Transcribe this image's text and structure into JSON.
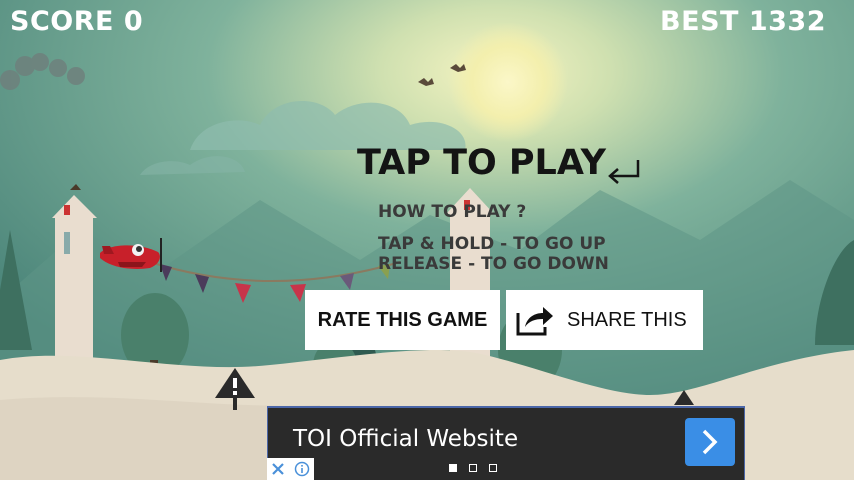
{
  "hud": {
    "score_label": "SCORE",
    "score_value": "0",
    "best_label": "BEST",
    "best_value": "1332"
  },
  "menu": {
    "tap_to_play": "TAP TO PLAY",
    "how_to_play": "HOW TO PLAY ?",
    "instruction_up": "TAP & HOLD - TO GO UP",
    "instruction_down": "RELEASE - TO GO DOWN",
    "rate_button": "RATE THIS GAME",
    "share_button": "SHARE THIS"
  },
  "ad": {
    "title": "TOI Official Website",
    "page_indicator": {
      "current": 1,
      "total": 3
    }
  },
  "colors": {
    "sky": "#5e9a8a",
    "sun_glow": "#f4f0b0",
    "ground": "#e4dccb",
    "plane": "#c8202a",
    "ad_accent": "#3a8ee6"
  },
  "icons": [
    "enter-arrow-icon",
    "share-icon",
    "chevron-right-icon",
    "close-icon",
    "info-icon",
    "warning-sign-icon"
  ]
}
